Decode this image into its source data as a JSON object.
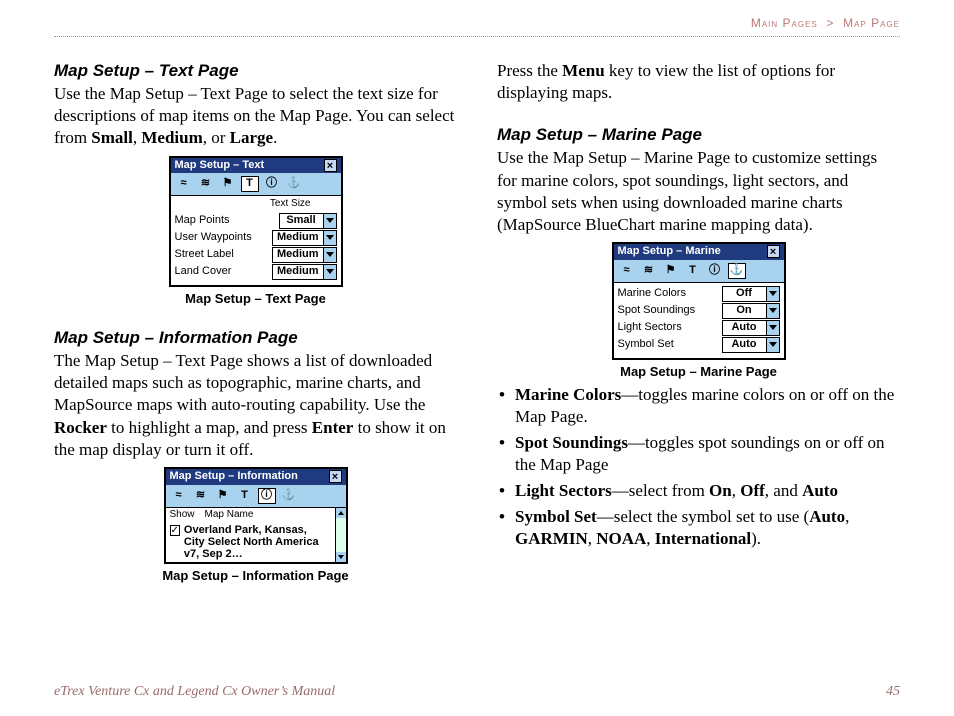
{
  "breadcrumb": {
    "section": "Main Pages",
    "sep": ">",
    "page": "Map Page"
  },
  "footer_left": "eTrex Venture Cx and Legend Cx Owner’s Manual",
  "footer_right": "45",
  "left": {
    "h_text": "Map Setup – Text Page",
    "p_text_1": "Use the Map Setup – Text Page to select the text size for descriptions of map items on the Map Page. You can select from ",
    "p_text_small": "Small",
    "p_text_comma1": ", ",
    "p_text_medium": "Medium",
    "p_text_or": ", or ",
    "p_text_large": "Large",
    "p_text_end": ".",
    "caption_text": "Map Setup – Text Page",
    "h_info": "Map Setup – Information Page",
    "p_info_1": "The Map Setup – Text Page shows a list of downloaded detailed maps such as topographic, marine charts, and MapSource maps with auto-routing capability. Use the ",
    "p_info_rocker": "Rocker",
    "p_info_2": " to highlight a map, and press ",
    "p_info_enter": "Enter",
    "p_info_3": " to show it on the map display or turn it off.",
    "caption_info": "Map Setup – Information Page"
  },
  "right": {
    "p_top_1": "Press the ",
    "p_top_menu": "Menu",
    "p_top_2": " key to view the list of options for displaying maps.",
    "h_marine": "Map Setup – Marine Page",
    "p_marine": "Use the Map Setup – Marine Page to customize settings for marine colors, spot soundings, light sectors, and symbol sets when using downloaded marine charts (MapSource BlueChart marine mapping data).",
    "caption_marine": "Map Setup – Marine Page",
    "b1_key": "Marine Colors",
    "b1_text": "—toggles marine colors on or off on the Map Page.",
    "b2_key": "Spot Soundings",
    "b2_text": "—toggles spot soundings on or off on the Map Page",
    "b3_key": "Light Sectors",
    "b3_text_1": "—select from ",
    "b3_on": "On",
    "b3_c1": ", ",
    "b3_off": "Off",
    "b3_c2": ", and ",
    "b3_auto": "Auto",
    "b4_key": "Symbol Set",
    "b4_text_1": "—select the symbol set to use (",
    "b4_auto": "Auto",
    "b4_c1": ", ",
    "b4_garmin": "GARMIN",
    "b4_c2": ", ",
    "b4_noaa": "NOAA",
    "b4_c3": ", ",
    "b4_intl": "International",
    "b4_end": ")."
  },
  "dlg_text": {
    "title": "Map Setup – Text",
    "close": "×",
    "tabs": [
      "≈",
      "≋",
      "⚑",
      "T",
      "ⓘ",
      "⚓"
    ],
    "subhead": "Text Size",
    "rows": [
      {
        "label": "Map Points",
        "value": "Small"
      },
      {
        "label": "User Waypoints",
        "value": "Medium"
      },
      {
        "label": "Street Label",
        "value": "Medium"
      },
      {
        "label": "Land Cover",
        "value": "Medium"
      }
    ]
  },
  "dlg_info": {
    "title": "Map Setup – Information",
    "close": "×",
    "tabs": [
      "≈",
      "≋",
      "⚑",
      "T",
      "ⓘ",
      "⚓"
    ],
    "col_show": "Show",
    "col_name": "Map Name",
    "check": "✓",
    "item": "Overland Park, Kansas, City Select North America v7, Sep 2…"
  },
  "dlg_marine": {
    "title": "Map Setup – Marine",
    "close": "×",
    "tabs": [
      "≈",
      "≋",
      "⚑",
      "T",
      "ⓘ",
      "⚓"
    ],
    "rows": [
      {
        "label": "Marine Colors",
        "value": "Off"
      },
      {
        "label": "Spot Soundings",
        "value": "On"
      },
      {
        "label": "Light Sectors",
        "value": "Auto"
      },
      {
        "label": "Symbol Set",
        "value": "Auto"
      }
    ]
  }
}
